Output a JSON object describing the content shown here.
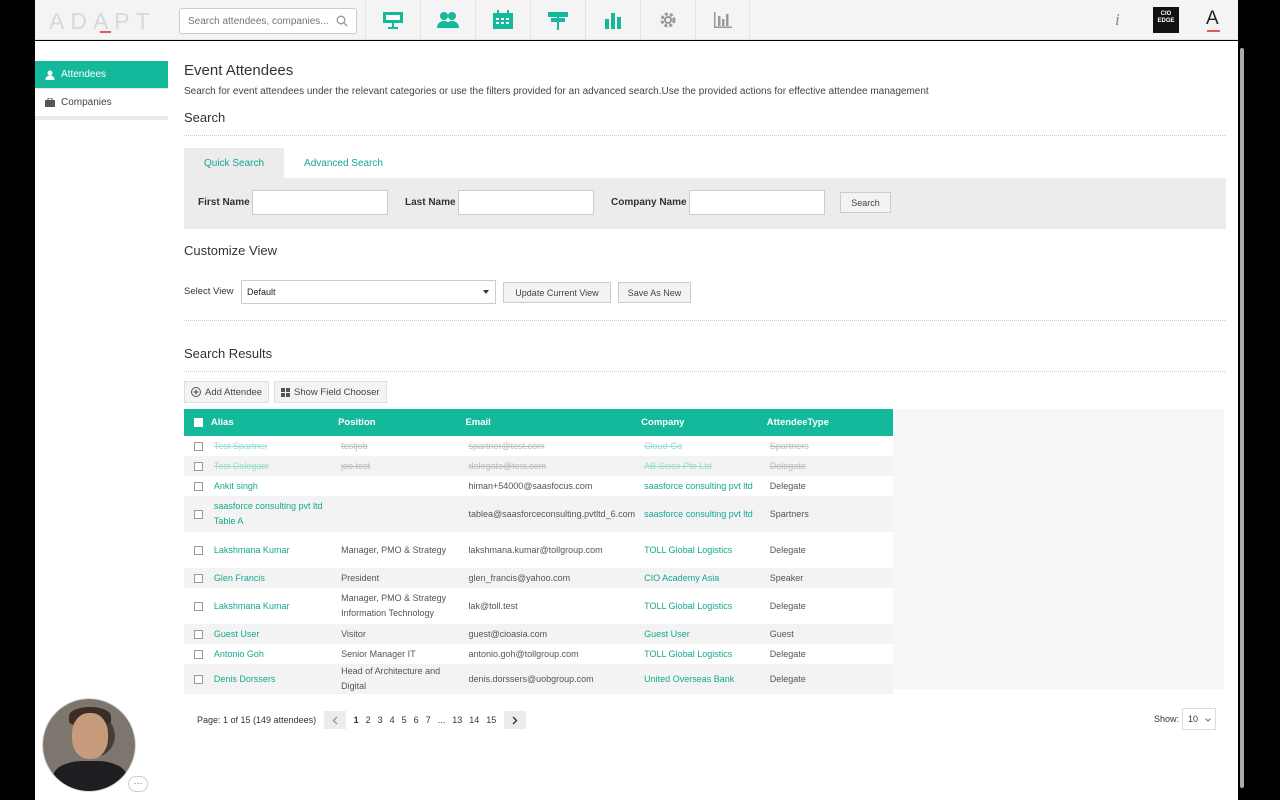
{
  "app": {
    "logo": "ADAPT",
    "search_placeholder": "Search attendees, companies...",
    "nav_icons": [
      "presentation-icon",
      "people-icon",
      "calendar-icon",
      "signpost-icon",
      "bar-chart-icon",
      "gear-icon",
      "histogram-icon"
    ],
    "info_label": "i",
    "cio_badge": "CIO EDGE",
    "a_badge": "A",
    "accent_color": "#14b89a"
  },
  "sidebar": {
    "items": [
      {
        "label": "Attendees",
        "icon": "user-icon",
        "active": true
      },
      {
        "label": "Companies",
        "icon": "briefcase-icon",
        "active": false
      }
    ]
  },
  "page": {
    "title": "Event Attendees",
    "subtitle": "Search for event attendees under the relevant categories or use the filters provided for an advanced search.Use the provided actions for effective attendee management"
  },
  "search": {
    "title": "Search",
    "tabs": [
      "Quick Search",
      "Advanced Search"
    ],
    "active_tab": "Quick Search",
    "first_name_label": "First Name",
    "last_name_label": "Last Name",
    "company_name_label": "Company Name",
    "first_name_value": "",
    "last_name_value": "",
    "company_name_value": "",
    "search_button": "Search"
  },
  "customize": {
    "title": "Customize View",
    "select_label": "Select View",
    "selected_view": "Default",
    "update_button": "Update Current View",
    "save_button": "Save As New"
  },
  "results": {
    "title": "Search Results",
    "add_button": "Add Attendee",
    "field_chooser_button": "Show Field Chooser",
    "columns": [
      "Alias",
      "Position",
      "Email",
      "Company",
      "AttendeeType"
    ],
    "rows": [
      {
        "alias": "Test Spartner",
        "position": "testjob",
        "email": "spartner@test.com",
        "company": "Cloud Go",
        "type": "Spartners",
        "struck": true
      },
      {
        "alias": "Test Delegate",
        "position": "joe.test",
        "email": "delegate@test.com",
        "company": "AB Sciex Pte Ltd",
        "type": "Delegate",
        "struck": true
      },
      {
        "alias": "Ankit singh",
        "position": "",
        "email": "himan+54000@saasfocus.com",
        "company": "saasforce consulting pvt ltd",
        "type": "Delegate",
        "struck": false
      },
      {
        "alias": "saasforce consulting pvt ltd Table A",
        "position": "",
        "email": "tablea@saasforceconsulting.pvtltd_6.com",
        "company": "saasforce consulting pvt ltd",
        "type": "Spartners",
        "struck": false
      },
      {
        "alias": "Lakshmana Kumar",
        "position": "Manager, PMO & Strategy",
        "email": "lakshmana.kumar@tollgroup.com",
        "company": "TOLL Global Logistics",
        "type": "Delegate",
        "struck": false
      },
      {
        "alias": "Glen Francis",
        "position": "President",
        "email": "glen_francis@yahoo.com",
        "company": "CIO Academy Asia",
        "type": "Speaker",
        "struck": false
      },
      {
        "alias": "Lakshmana Kumar",
        "position": "Manager, PMO & Strategy Information Technology",
        "email": "lak@toll.test",
        "company": "TOLL Global Logistics",
        "type": "Delegate",
        "struck": false
      },
      {
        "alias": "Guest User",
        "position": "Visitor",
        "email": "guest@cioasia.com",
        "company": "Guest User",
        "type": "Guest",
        "struck": false
      },
      {
        "alias": "Antonio Goh",
        "position": "Senior Manager IT",
        "email": "antonio.goh@tollgroup.com",
        "company": "TOLL Global Logistics",
        "type": "Delegate",
        "struck": false
      },
      {
        "alias": "Denis Dorssers",
        "position": "Head of Architecture and Digital",
        "email": "denis.dorssers@uobgroup.com",
        "company": "United Overseas Bank",
        "type": "Delegate",
        "struck": false
      }
    ]
  },
  "pagination": {
    "summary": "Page: 1 of 15 (149 attendees)",
    "pages": [
      "1",
      "2",
      "3",
      "4",
      "5",
      "6",
      "7",
      "...",
      "13",
      "14",
      "15"
    ],
    "current": "1",
    "show_label": "Show:",
    "page_size": "10"
  }
}
